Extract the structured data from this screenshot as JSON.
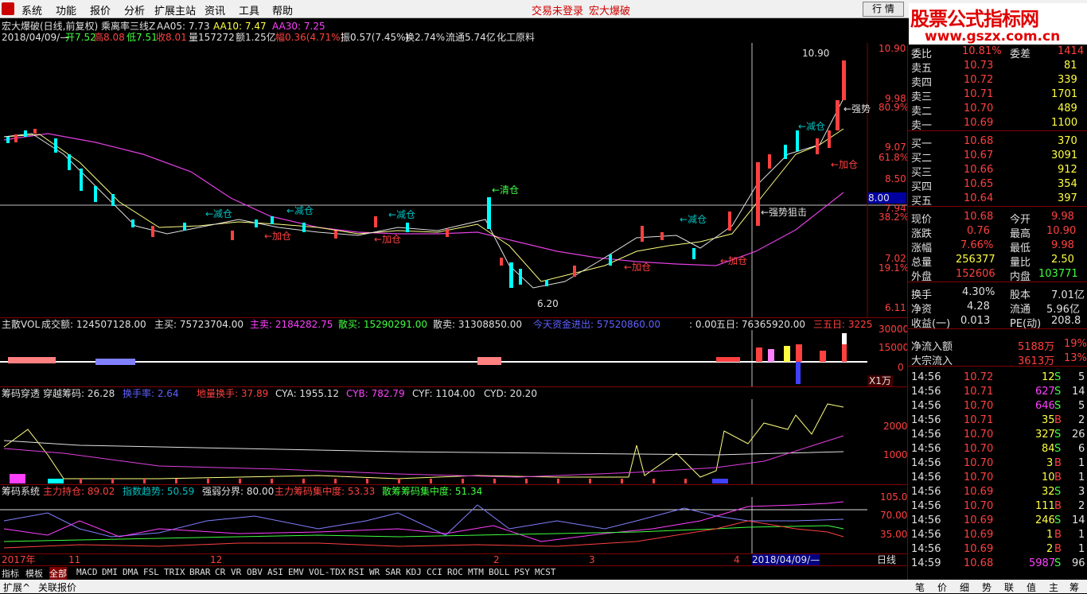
{
  "menu": {
    "items": [
      "系统",
      "功能",
      "报价",
      "分析",
      "扩展主站",
      "资讯",
      "工具",
      "帮助"
    ],
    "center_left": "交易未登录",
    "center_right": "宏大爆破",
    "btn_quote": "行 情",
    "btn_info": "资 讯"
  },
  "brand": {
    "line1": "股票公式指标网",
    "line2": "www.gszx.com.cn"
  },
  "header": {
    "line1": "宏大爆破(日线,前复权) 乘离率三线Z",
    "aa05": "AA05: 7.73",
    "aa10": "AA10: 7.47",
    "aa30": "AA30: 7.25",
    "date": "2018/04/09/—",
    "open": "开7.52",
    "high": "高8.08",
    "low": "低7.51",
    "close": "收8.01",
    "vol": "量157272",
    "amt": "额1.25亿",
    "chg": "幅0.36(4.71%)",
    "amp": "振0.57(7.45%)",
    "turn": "换2.74%",
    "float": "流通5.74亿",
    "sector": "化工原料"
  },
  "price_axis": {
    "p1": "10.90",
    "p2": "9.98",
    "pct1": "80.9%",
    "p3": "9.07",
    "pct2": "61.8%",
    "p4": "8.50",
    "p5": "8.00",
    "p6": "7.94",
    "pct3": "38.2%",
    "p7": "7.02",
    "pct4": "19.1%",
    "p8": "6.11"
  },
  "annotations": {
    "high": "10.90",
    "low": "6.20",
    "strong": "←强势",
    "strong_block": "←强势狙击",
    "reduce": "←减仓",
    "add": "←加仓",
    "clear": "←清仓"
  },
  "vol_header": {
    "title": "主散VOL",
    "amt": "成交额: 124507128.00",
    "buy": "主买: 75723704.00",
    "sell": "主卖: 2184282.75",
    "sbuy": "散买: 15290291.00",
    "ssell": "散卖: 31308850.00",
    "today": "今天资金进出: 57520860.00",
    "zero": ": 0.00",
    "five": "五日: 76365920.00",
    "three5": "三五日: 3225"
  },
  "vol_axis": {
    "a": "30000",
    "b": "15000",
    "c": "0",
    "unit": "X1万"
  },
  "chip_header": {
    "title": "筹码穿透",
    "cross": "穿越筹码: 26.28",
    "turn": "换手率: 2.64",
    "low": "地量换手: 37.89",
    "cya": "CYA: 1955.12",
    "cyb": "CYB: 782.79",
    "cyf": "CYF: 1104.00",
    "cyd": "CYD: 20.20"
  },
  "chip_axis": {
    "a": "2000",
    "b": "1000"
  },
  "sys_header": {
    "title": "筹码系统",
    "main": "主力持仓: 89.02",
    "trend": "指数趋势: 50.59",
    "strong": "强弱分界: 80.00",
    "conc": "主力筹码集中度: 53.33",
    "scatter": "散筹筹码集中度: 51.34"
  },
  "sys_axis": {
    "a": "105.0",
    "b": "70.00",
    "c": "35.00"
  },
  "dates": {
    "y": "2017年",
    "m11": "11",
    "m12": "12",
    "m2": "2",
    "m3": "3",
    "m4": "4",
    "cur": "2018/04/09/—",
    "period": "日线"
  },
  "tabs": [
    "指标",
    "模板",
    "全部",
    "MACD",
    "DMI",
    "DMA",
    "FSL",
    "TRIX",
    "BRAR",
    "CR",
    "VR",
    "OBV",
    "ASI",
    "EMV",
    "VOL-TDX",
    "RSI",
    "WR",
    "SAR",
    "KDJ",
    "CCI",
    "ROC",
    "MTM",
    "BOLL",
    "PSY",
    "MCST"
  ],
  "status": {
    "ext": "扩展^",
    "news": "关联报价"
  },
  "right_tabs": [
    "笔",
    "价",
    "细",
    "势",
    "联",
    "值",
    "主",
    "筹"
  ],
  "order_book": {
    "top": {
      "label": "委比",
      "val": "10.81%",
      "label2": "委差",
      "val2": "1414"
    },
    "asks": [
      {
        "l": "卖五",
        "p": "10.73",
        "v": "81"
      },
      {
        "l": "卖四",
        "p": "10.72",
        "v": "339"
      },
      {
        "l": "卖三",
        "p": "10.71",
        "v": "1701"
      },
      {
        "l": "卖二",
        "p": "10.70",
        "v": "489"
      },
      {
        "l": "卖一",
        "p": "10.69",
        "v": "1100"
      }
    ],
    "bids": [
      {
        "l": "买一",
        "p": "10.68",
        "v": "370"
      },
      {
        "l": "买二",
        "p": "10.67",
        "v": "3091"
      },
      {
        "l": "买三",
        "p": "10.66",
        "v": "912"
      },
      {
        "l": "买四",
        "p": "10.65",
        "v": "354"
      },
      {
        "l": "买五",
        "p": "10.64",
        "v": "397"
      }
    ]
  },
  "stats": [
    {
      "l": "现价",
      "v": "10.68",
      "l2": "今开",
      "v2": "9.98"
    },
    {
      "l": "涨跌",
      "v": "0.76",
      "l2": "最高",
      "v2": "10.90"
    },
    {
      "l": "涨幅",
      "v": "7.66%",
      "l2": "最低",
      "v2": "9.98"
    },
    {
      "l": "总量",
      "v": "256377",
      "l2": "量比",
      "v2": "2.50"
    },
    {
      "l": "外盘",
      "v": "152606",
      "l2": "内盘",
      "v2": "103771"
    },
    {
      "l": "换手",
      "v": "4.30%",
      "l2": "股本",
      "v2": "7.01亿"
    },
    {
      "l": "净资",
      "v": "4.28",
      "l2": "流通",
      "v2": "5.96亿"
    },
    {
      "l": "收益(一)",
      "v": "0.013",
      "l2": "PE(动)",
      "v2": "208.8"
    }
  ],
  "flow": [
    {
      "l": "净流入额",
      "v": "5188万",
      "p": "19%"
    },
    {
      "l": "大宗流入",
      "v": "3613万",
      "p": "13%"
    }
  ],
  "ticks": [
    {
      "t": "14:56",
      "p": "10.72",
      "v": "12",
      "d": "S",
      "n": "5"
    },
    {
      "t": "14:56",
      "p": "10.71",
      "v": "627",
      "d": "S",
      "n": "14"
    },
    {
      "t": "14:56",
      "p": "10.70",
      "v": "646",
      "d": "S",
      "n": "5"
    },
    {
      "t": "14:56",
      "p": "10.71",
      "v": "35",
      "d": "B",
      "n": "2"
    },
    {
      "t": "14:56",
      "p": "10.70",
      "v": "327",
      "d": "S",
      "n": "26"
    },
    {
      "t": "14:56",
      "p": "10.70",
      "v": "84",
      "d": "S",
      "n": "6"
    },
    {
      "t": "14:56",
      "p": "10.70",
      "v": "3",
      "d": "B",
      "n": "1"
    },
    {
      "t": "14:56",
      "p": "10.70",
      "v": "10",
      "d": "B",
      "n": "1"
    },
    {
      "t": "14:56",
      "p": "10.69",
      "v": "32",
      "d": "S",
      "n": "3"
    },
    {
      "t": "14:56",
      "p": "10.70",
      "v": "111",
      "d": "B",
      "n": "2"
    },
    {
      "t": "14:56",
      "p": "10.69",
      "v": "246",
      "d": "S",
      "n": "14"
    },
    {
      "t": "14:56",
      "p": "10.69",
      "v": "1",
      "d": "B",
      "n": "1"
    },
    {
      "t": "14:56",
      "p": "10.69",
      "v": "2",
      "d": "B",
      "n": "1"
    },
    {
      "t": "14:59",
      "p": "10.68",
      "v": "5987",
      "d": "S",
      "n": "96"
    }
  ],
  "cursor_price": "8.00"
}
